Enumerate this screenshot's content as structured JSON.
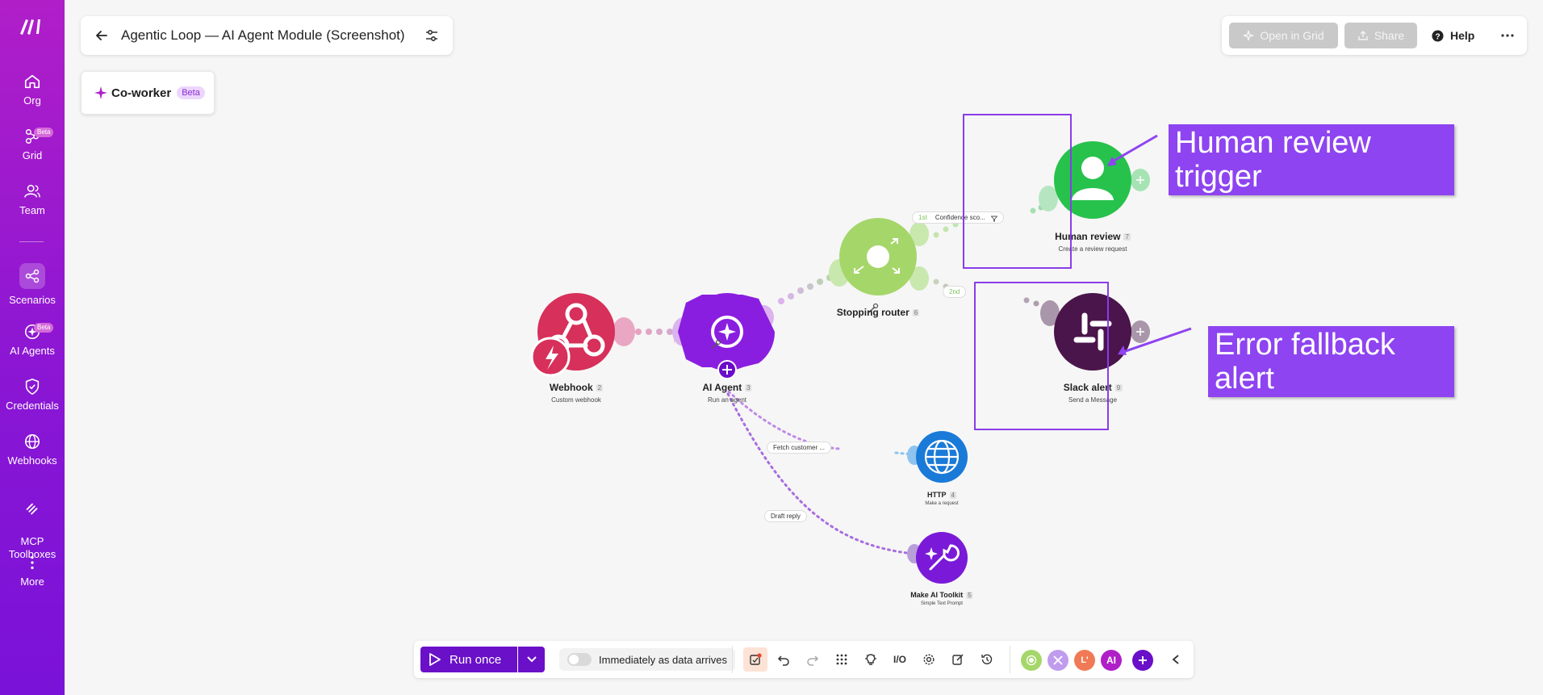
{
  "sidebar": {
    "items": [
      {
        "label": "Org",
        "icon": "home-icon"
      },
      {
        "label": "Grid",
        "icon": "grid-icon",
        "badge": "Beta"
      },
      {
        "label": "Team",
        "icon": "team-icon"
      },
      {
        "label": "Scenarios",
        "icon": "scenarios-icon",
        "active": true
      },
      {
        "label": "AI Agents",
        "icon": "ai-agents-icon",
        "badge": "Beta"
      },
      {
        "label": "Credentials",
        "icon": "shield-icon"
      },
      {
        "label": "Webhooks",
        "icon": "globe-icon"
      },
      {
        "label": "MCP\nToolboxes",
        "icon": "toolbox-icon"
      },
      {
        "label": "More",
        "icon": "more-vertical-icon"
      }
    ]
  },
  "header": {
    "title": "Agentic Loop — AI Agent Module (Screenshot)",
    "coworker_label": "Co-worker",
    "coworker_badge": "Beta",
    "open_in_grid": "Open in Grid",
    "share": "Share",
    "help": "Help"
  },
  "nodes": {
    "webhook": {
      "name": "Webhook",
      "num": "2",
      "sub": "Custom webhook",
      "color": "#d7305a"
    },
    "agent": {
      "name": "AI Agent",
      "num": "3",
      "sub": "Run an agent",
      "color": "#8a1ee0"
    },
    "router": {
      "name": "Stopping router",
      "num": "6",
      "color": "#a5d66a"
    },
    "human": {
      "name": "Human review",
      "num": "7",
      "sub": "Create a review request",
      "color": "#27c24c"
    },
    "slack": {
      "name": "Slack alert",
      "num": "9",
      "sub": "Send a Message",
      "color": "#4a154b"
    },
    "http": {
      "name": "HTTP",
      "num": "4",
      "sub": "Make a request",
      "color": "#1a7ad8"
    },
    "toolkit": {
      "name": "Make AI Toolkit",
      "num": "5",
      "sub": "Simple Text Prompt",
      "color": "#7a1ad8"
    }
  },
  "edges": {
    "first_route": "1st",
    "first_filter": "Confidence sco...",
    "second_route": "2nd",
    "fetch": "Fetch customer ...",
    "draft": "Draft reply"
  },
  "annotations": {
    "human_review": "Human review trigger",
    "error_fallback": "Error fallback alert",
    "color": "#8e44f0"
  },
  "toolbar": {
    "run_once": "Run once",
    "schedule_label": "Immediately as data arrives",
    "avatar_l": "L'",
    "avatar_ai": "AI"
  }
}
